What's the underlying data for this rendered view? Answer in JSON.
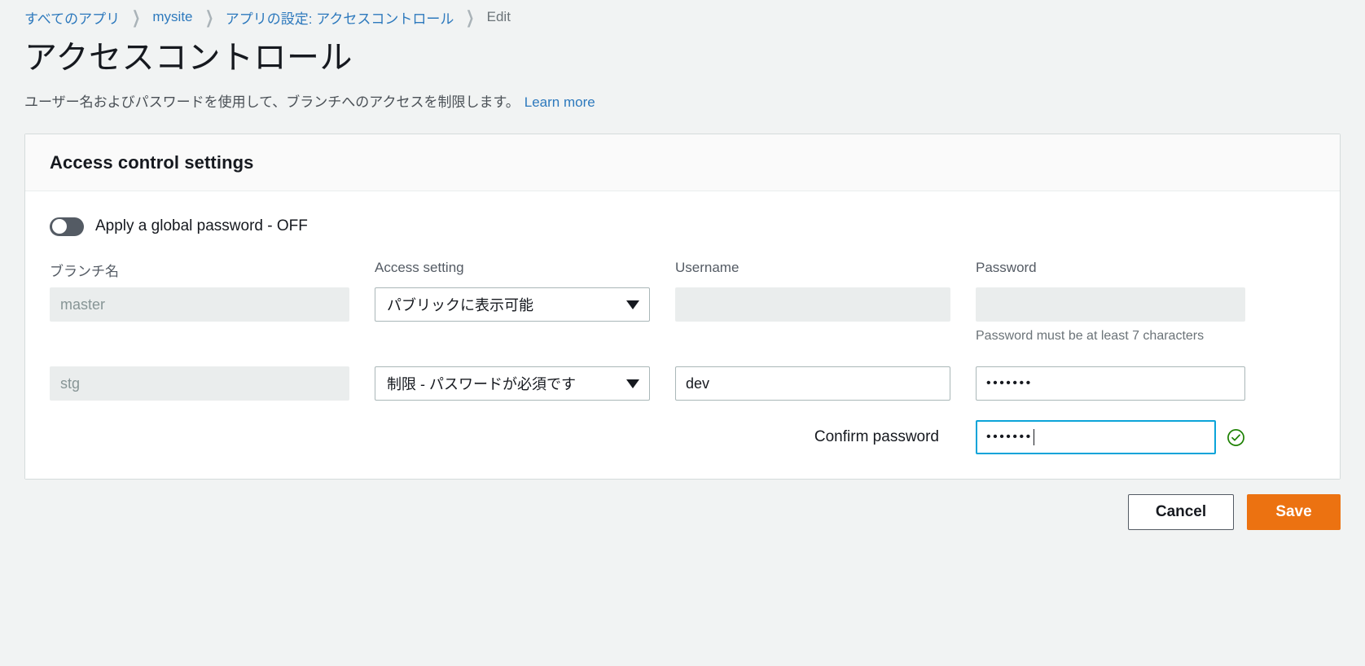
{
  "breadcrumb": {
    "items": [
      {
        "label": "すべてのアプリ",
        "current": false
      },
      {
        "label": "mysite",
        "current": false
      },
      {
        "label": "アプリの設定: アクセスコントロール",
        "current": false
      },
      {
        "label": "Edit",
        "current": true
      }
    ],
    "separator": "❯",
    "link_color": "#2d79bd",
    "current_color": "#6b7378"
  },
  "page": {
    "title": "アクセスコントロール",
    "description": "ユーザー名およびパスワードを使用して、ブランチへのアクセスを制限します。",
    "learn_more": "Learn more"
  },
  "card": {
    "header_title": "Access control settings",
    "toggle": {
      "label": "Apply a global password - OFF",
      "state": "off",
      "track_color": "#545b64"
    },
    "columns": [
      {
        "key": "branch",
        "label": "ブランチ名"
      },
      {
        "key": "access",
        "label": "Access setting"
      },
      {
        "key": "username",
        "label": "Username"
      },
      {
        "key": "password",
        "label": "Password"
      }
    ],
    "rows": [
      {
        "branch": "master",
        "branch_disabled": true,
        "access_setting": "パブリックに表示可能",
        "username": "",
        "username_disabled": true,
        "password": "",
        "password_disabled": true,
        "password_hint": "Password must be at least 7 characters"
      },
      {
        "branch": "stg",
        "branch_disabled": true,
        "access_setting": "制限 - パスワードが必須です",
        "username": "dev",
        "username_disabled": false,
        "password": "•••••••",
        "password_disabled": false,
        "password_hint": ""
      }
    ],
    "confirm": {
      "label": "Confirm password",
      "value": "•••••••",
      "focused": true,
      "focus_color": "#0ba4d9",
      "valid": true,
      "valid_icon": "check-circle-icon",
      "valid_color": "#1d8102"
    }
  },
  "footer": {
    "cancel_label": "Cancel",
    "save_label": "Save",
    "save_color": "#ec7211"
  }
}
